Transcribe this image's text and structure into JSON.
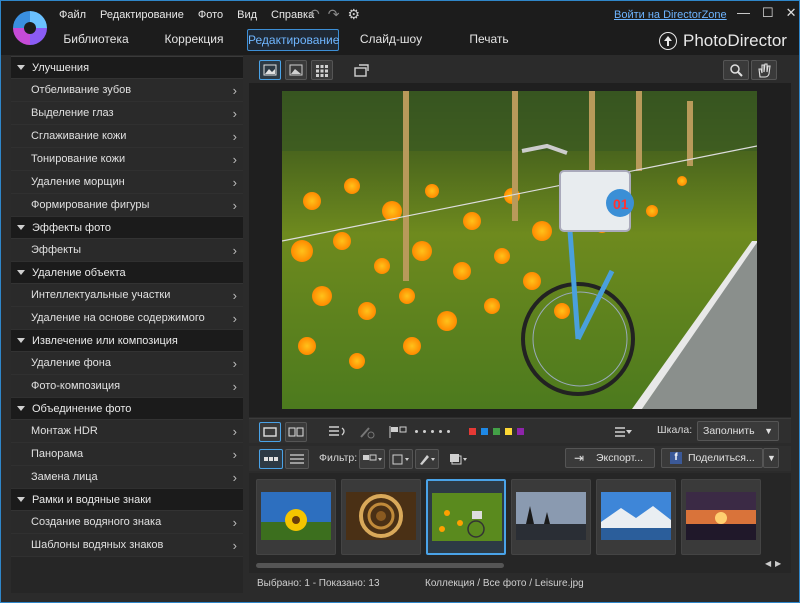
{
  "menu": [
    "Файл",
    "Редактирование",
    "Фото",
    "Вид",
    "Справка"
  ],
  "login": "Войти на DirectorZone",
  "tabs": [
    "Библиотека",
    "Коррекция",
    "Редактирование",
    "Слайд-шоу",
    "Печать"
  ],
  "active_tab": "Редактирование",
  "brand": "PhotoDirector",
  "sidebar": [
    {
      "section": "Улучшения",
      "items": [
        "Отбеливание зубов",
        "Выделение глаз",
        "Сглаживание кожи",
        "Тонирование кожи",
        "Удаление морщин",
        "Формирование фигуры"
      ]
    },
    {
      "section": "Эффекты фото",
      "items": [
        "Эффекты"
      ]
    },
    {
      "section": "Удаление объекта",
      "items": [
        "Интеллектуальные участки",
        "Удаление на основе содержимого"
      ]
    },
    {
      "section": "Извлечение или композиция",
      "items": [
        "Удаление фона",
        "Фото-композиция"
      ]
    },
    {
      "section": "Объединение фото",
      "items": [
        "Монтаж HDR",
        "Панорама",
        "Замена лица"
      ]
    },
    {
      "section": "Рамки и водяные знаки",
      "items": [
        "Создание водяного знака",
        "Шаблоны водяных знаков"
      ]
    }
  ],
  "scale": {
    "label": "Шкала:",
    "value": "Заполнить"
  },
  "filter_label": "Фильтр:",
  "export_label": "Экспорт...",
  "share_label": "Поделиться...",
  "color_labels": [
    "#e53935",
    "#1e88e5",
    "#43a047",
    "#fdd835",
    "#8e24aa"
  ],
  "status": {
    "left": "Выбрано: 1 - Показано: 13",
    "path": "Коллекция / Все фото / Leisure.jpg"
  }
}
